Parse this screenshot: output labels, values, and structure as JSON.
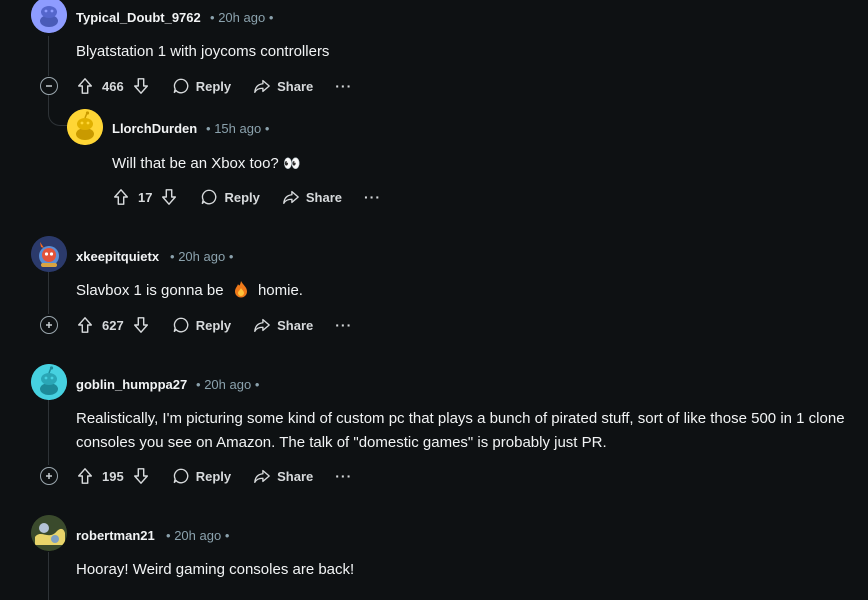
{
  "comments": [
    {
      "username": "Typical_Doubt_9762",
      "time": "20h ago",
      "text": "Blyatstation 1 with joycoms controllers",
      "votes": "466",
      "reply": "Reply",
      "share": "Share",
      "more": "···"
    },
    {
      "username": "LlorchDurden",
      "time": "15h ago",
      "text": "Will that be an Xbox too?",
      "emoji": "👀",
      "votes": "17",
      "reply": "Reply",
      "share": "Share",
      "more": "···"
    },
    {
      "username": "xkeepitquietx",
      "time": "20h ago",
      "text_before": "Slavbox 1 is gonna be",
      "text_after": "homie.",
      "votes": "627",
      "reply": "Reply",
      "share": "Share",
      "more": "···"
    },
    {
      "username": "goblin_humppa27",
      "time": "20h ago",
      "text": "Realistically, I'm picturing some kind of custom pc that plays a bunch of pirated stuff, sort of like those 500 in 1 clone consoles you see on Amazon. The talk of \"domestic games\" is probably just PR.",
      "votes": "195",
      "reply": "Reply",
      "share": "Share",
      "more": "···"
    },
    {
      "username": "robertman21",
      "time": "20h ago",
      "text": "Hooray! Weird gaming consoles are back!"
    }
  ],
  "separator": "•",
  "colors": {
    "background": "#0e1113",
    "text": "#f2f4f5",
    "meta": "#8ba2ad",
    "thread": "#2e3337"
  }
}
